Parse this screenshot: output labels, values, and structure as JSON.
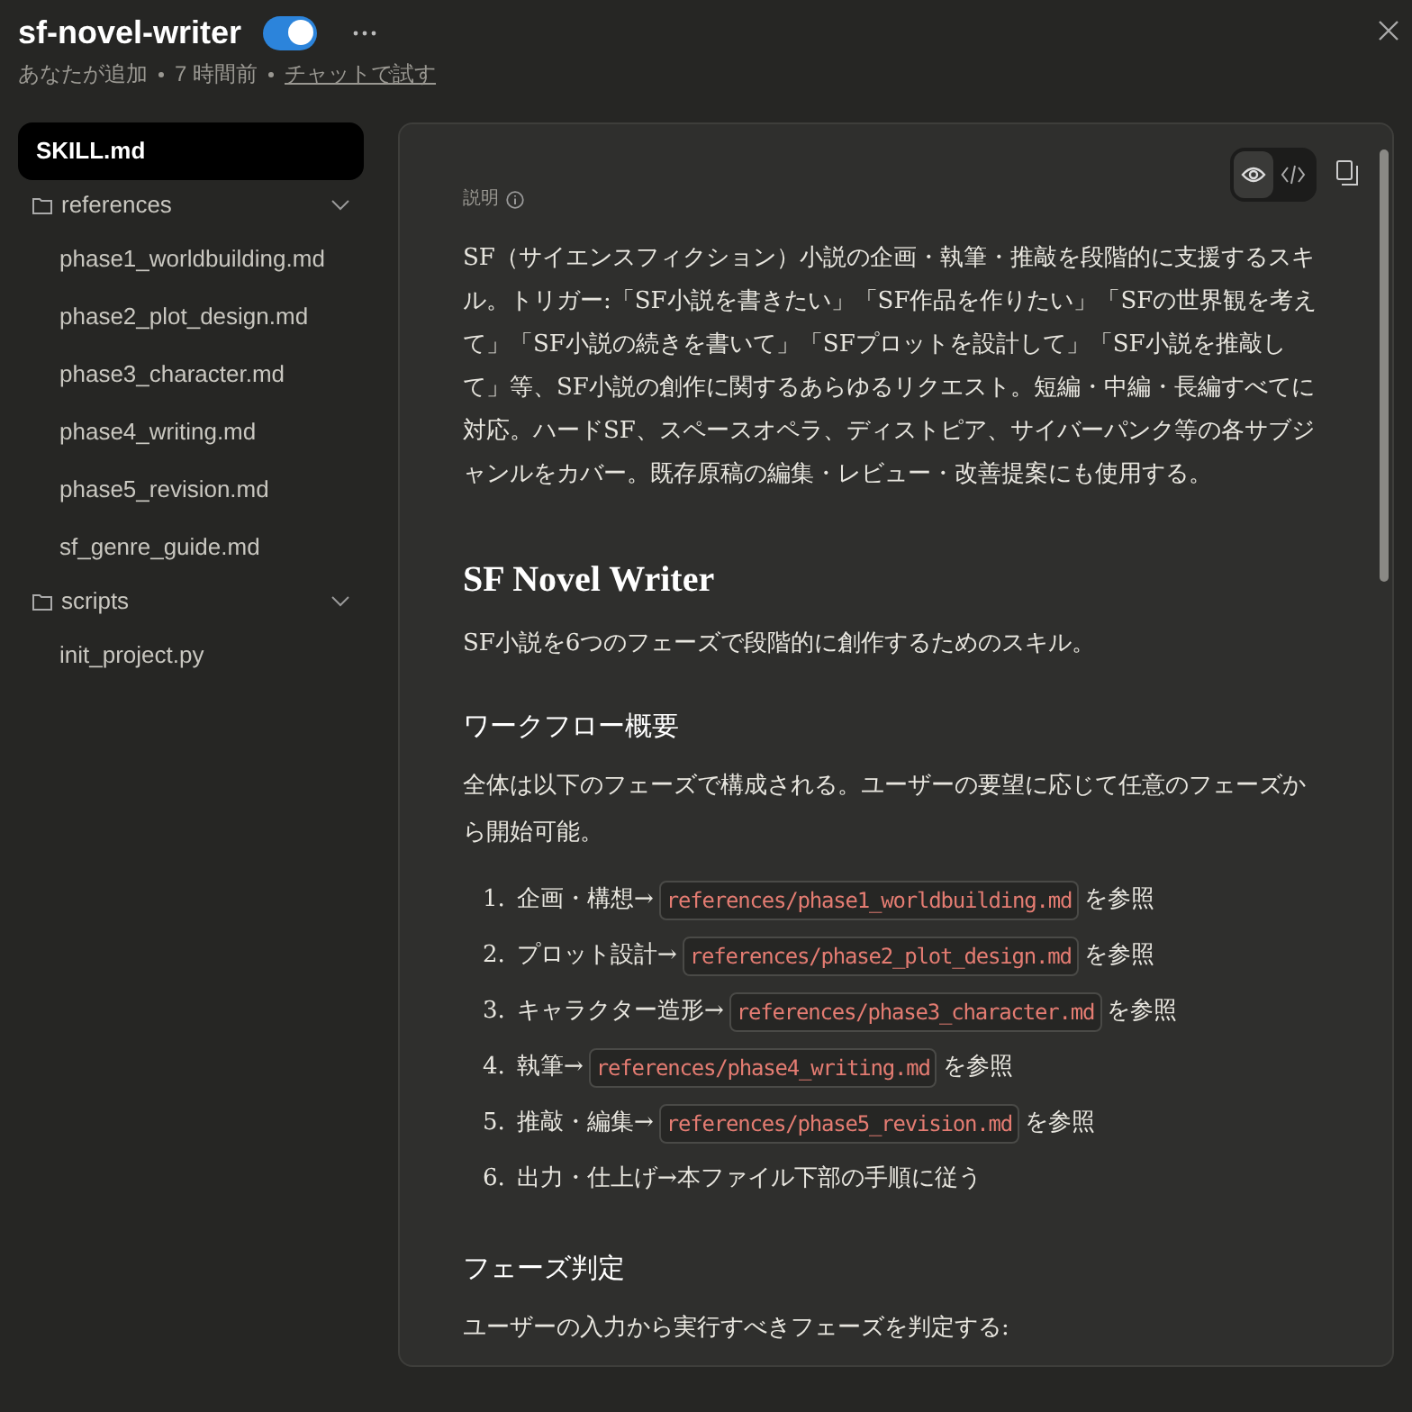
{
  "header": {
    "title": "sf-novel-writer",
    "enabled": true,
    "meta": {
      "added_by": "あなたが追加",
      "time": "7 時間前",
      "link": "チャットで試す"
    }
  },
  "sidebar": {
    "items": [
      {
        "kind": "file",
        "label": "SKILL.md",
        "selected": true
      },
      {
        "kind": "folder",
        "label": "references",
        "expanded": true,
        "children": [
          {
            "kind": "file",
            "label": "phase1_worldbuilding.md",
            "selected": false
          },
          {
            "kind": "file",
            "label": "phase2_plot_design.md",
            "selected": false
          },
          {
            "kind": "file",
            "label": "phase3_character.md",
            "selected": false
          },
          {
            "kind": "file",
            "label": "phase4_writing.md",
            "selected": false
          },
          {
            "kind": "file",
            "label": "phase5_revision.md",
            "selected": false
          },
          {
            "kind": "file",
            "label": "sf_genre_guide.md",
            "selected": false
          }
        ]
      },
      {
        "kind": "folder",
        "label": "scripts",
        "expanded": true,
        "children": [
          {
            "kind": "file",
            "label": "init_project.py",
            "selected": false
          }
        ]
      }
    ]
  },
  "viewer": {
    "view_modes": [
      {
        "kind": "preview",
        "selected": true
      },
      {
        "kind": "code",
        "selected": false
      }
    ],
    "description_label": "説明",
    "description": "SF（サイエンスフィクション）小説の企画・執筆・推敲を段階的に支援するスキル。トリガー:「SF小説を書きたい」「SF作品を作りたい」「SFの世界観を考えて」「SF小説の続きを書いて」「SFプロットを設計して」「SF小説を推敲して」等、SF小説の創作に関するあらゆるリクエスト。短編・中編・長編すべてに対応。ハードSF、スペースオペラ、ディストピア、サイバーパンク等の各サブジャンルをカバー。既存原稿の編集・レビュー・改善提案にも使用する。",
    "document": [
      {
        "kind": "h1",
        "text": "SF Novel Writer"
      },
      {
        "kind": "p",
        "text": "SF小説を6つのフェーズで段階的に創作するためのスキル。"
      },
      {
        "kind": "h2",
        "text": "ワークフロー概要"
      },
      {
        "kind": "p",
        "text": "全体は以下のフェーズで構成される。ユーザーの要望に応じて任意のフェーズから開始可能。"
      },
      {
        "kind": "ol",
        "items": [
          {
            "number": "1.",
            "text": "企画・構想→",
            "code": "references/phase1_worldbuilding.md",
            "suffix": "を参照"
          },
          {
            "number": "2.",
            "text": "プロット設計→",
            "code": "references/phase2_plot_design.md",
            "suffix": "を参照"
          },
          {
            "number": "3.",
            "text": "キャラクター造形→",
            "code": "references/phase3_character.md",
            "suffix": "を参照"
          },
          {
            "number": "4.",
            "text": "執筆→",
            "code": "references/phase4_writing.md",
            "suffix": "を参照"
          },
          {
            "number": "5.",
            "text": "推敲・編集→",
            "code": "references/phase5_revision.md",
            "suffix": "を参照"
          },
          {
            "number": "6.",
            "text": "出力・仕上げ→本ファイル下部の手順に従う"
          }
        ]
      },
      {
        "kind": "h2",
        "text": "フェーズ判定"
      },
      {
        "kind": "p",
        "text": "ユーザーの入力から実行すべきフェーズを判定する:"
      }
    ]
  }
}
